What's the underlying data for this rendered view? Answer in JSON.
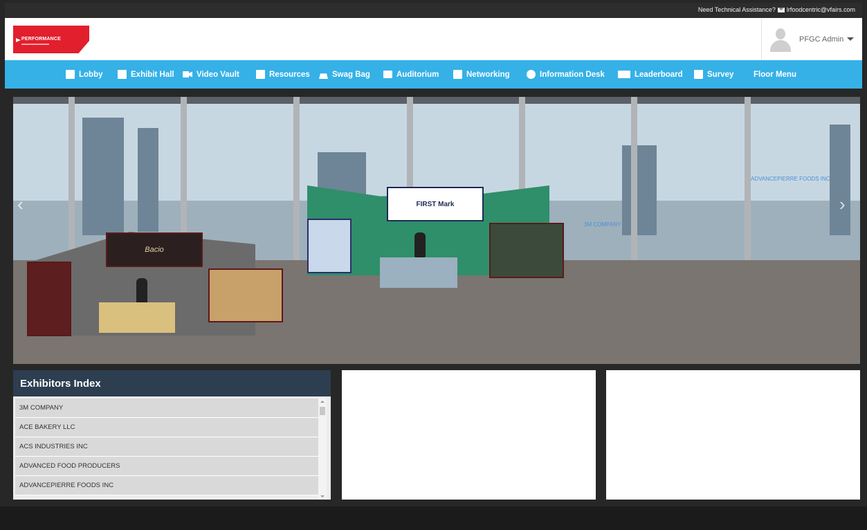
{
  "topbar": {
    "tech_text": "Need Technical Assistance?",
    "email": "lrfoodcentric@vfairs.com"
  },
  "header": {
    "logo_text": "PERFORMANCE",
    "user_name": "PFGC Admin"
  },
  "nav": {
    "items": [
      {
        "label": "Lobby",
        "icon": "building-icon"
      },
      {
        "label": "Exhibit Hall",
        "icon": "building-icon"
      },
      {
        "label": "Video Vault",
        "icon": "video-camera-icon"
      },
      {
        "label": "Resources",
        "icon": "document-icon"
      },
      {
        "label": "Swag Bag",
        "icon": "shopping-bag-icon"
      },
      {
        "label": "Auditorium",
        "icon": "list-icon"
      },
      {
        "label": "Networking",
        "icon": "document-icon"
      },
      {
        "label": "Information Desk",
        "icon": "info-icon"
      },
      {
        "label": "Leaderboard",
        "icon": "bars-icon"
      },
      {
        "label": "Survey",
        "icon": "survey-icon"
      },
      {
        "label": "Floor Menu",
        "icon": ""
      }
    ]
  },
  "scene": {
    "booth_labels": [
      "FIRST Mark",
      "Bacio"
    ],
    "overlay_labels": [
      "ADVANCEPIERRE FOODS INC",
      "3M COMPANY"
    ]
  },
  "exhibitors": {
    "title": "Exhibitors Index",
    "items": [
      "3M COMPANY",
      "ACE BAKERY LLC",
      "ACS INDUSTRIES INC",
      "ADVANCED FOOD PRODUCERS",
      "ADVANCEPIERRE FOODS INC"
    ]
  },
  "colors": {
    "nav_bg": "#35b1e7",
    "brand_red": "#e21f2d",
    "index_header": "#2c3e50"
  }
}
